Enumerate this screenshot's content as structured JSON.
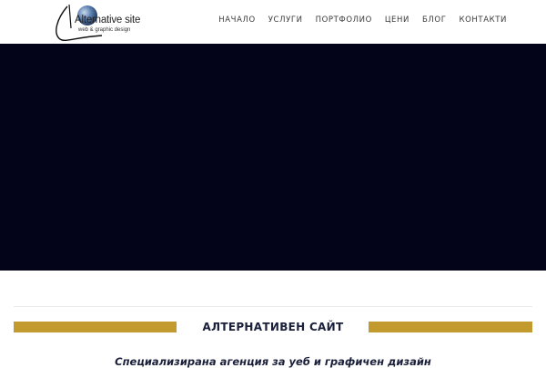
{
  "logo": {
    "title": "Alternative site",
    "subtitle": "web & graphic design",
    "globe_color": "#5a7fb0"
  },
  "nav": {
    "items": [
      {
        "label": "НАЧАЛО"
      },
      {
        "label": "УСЛУГИ"
      },
      {
        "label": "ПОРТФОЛИО"
      },
      {
        "label": "ЦЕНИ"
      },
      {
        "label": "БЛОГ"
      },
      {
        "label": "КОНТАКТИ"
      }
    ]
  },
  "hero": {
    "background": "#03041a"
  },
  "section": {
    "title": "АЛТЕРНАТИВЕН САЙТ",
    "accent_color": "#c39a2d",
    "tagline": "Специализирана агенция за уеб и графичен дизайн"
  }
}
